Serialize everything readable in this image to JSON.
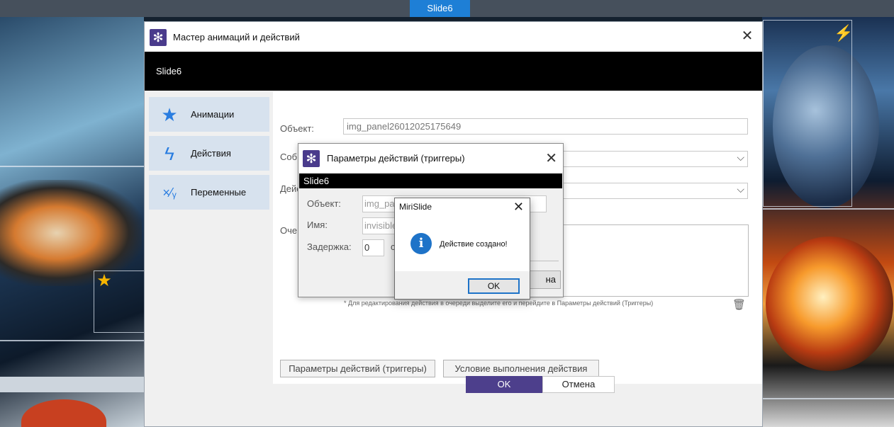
{
  "top_tab": {
    "label": "Slide6"
  },
  "wizard": {
    "title": "Мастер анимаций и действий",
    "header": "Slide6",
    "sidebar": {
      "items": [
        {
          "label": "Анимации",
          "icon": "star-icon"
        },
        {
          "label": "Действия",
          "icon": "lightning-icon"
        },
        {
          "label": "Переменные",
          "icon": "variables-icon"
        }
      ]
    },
    "fields": {
      "object_label": "Объект:",
      "object_value": "img_panel26012025175649",
      "event_label": "Собы",
      "action_label": "Дейс",
      "queue_label": "Очер"
    },
    "hint": "* Для редактирования действия в очереди выделите его и перейдите в Параметры действий (Триггеры)",
    "triggers_button": "Параметры действий (триггеры)",
    "condition_button": "Условие выполнения действия",
    "ok": "OK",
    "cancel": "Отмена"
  },
  "triggers": {
    "title": "Параметры действий (триггеры)",
    "header": "Slide6",
    "object_label": "Объект:",
    "object_value": "img_pa",
    "name_label": "Имя:",
    "name_value": "invisible",
    "delay_label": "Задержка:",
    "delay_value": "0",
    "delay_unit": "с",
    "button_partial": "на"
  },
  "message": {
    "title": "MiriSlide",
    "text": "Действие создано!",
    "ok": "OK"
  },
  "colors": {
    "accent": "#4d3f8c",
    "tab_blue": "#1e7fd6",
    "sidebar_bg": "#d7e2ee",
    "icon_blue": "#2a7de0"
  }
}
